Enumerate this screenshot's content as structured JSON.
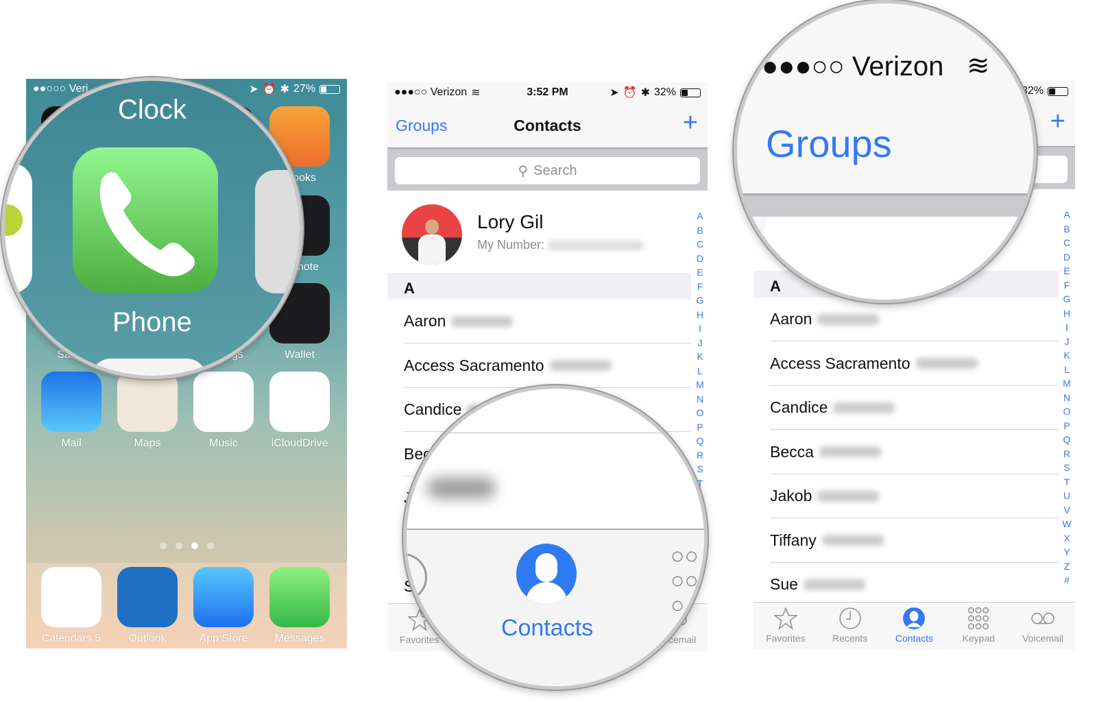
{
  "home": {
    "status": {
      "carrier": "●●○○○ Veri",
      "battery": "27%",
      "battery_level": 0.27
    },
    "magnifier": {
      "top_label": "Clock",
      "app_label": "Phone"
    },
    "rows": [
      [
        {
          "label": "",
          "icon": "clock-icon",
          "bg": "#111"
        },
        {
          "label": "",
          "icon": "blank",
          "bg": "#111"
        },
        {
          "label": "",
          "icon": "blank",
          "bg": "#111"
        },
        {
          "label": "iBooks",
          "icon": "book-icon",
          "bg": "linear-gradient(#f5a43a,#ef6c2c)"
        }
      ],
      [
        {
          "label": "",
          "icon": "blank",
          "bg": "transparent"
        },
        {
          "label": "",
          "icon": "blank",
          "bg": "transparent"
        },
        {
          "label": "",
          "icon": "blank",
          "bg": "transparent"
        },
        {
          "label": "Remote",
          "icon": "tv-icon",
          "bg": "#1c1c1e"
        }
      ],
      [
        {
          "label": "Safari",
          "icon": "blank",
          "bg": "transparent"
        },
        {
          "label": "",
          "icon": "blank",
          "bg": "transparent"
        },
        {
          "label": "Settings",
          "icon": "blank",
          "bg": "transparent"
        },
        {
          "label": "Wallet",
          "icon": "wallet-icon",
          "bg": "#1c1c1e"
        }
      ],
      [
        {
          "label": "Mail",
          "icon": "mail-icon",
          "bg": "linear-gradient(#1e73e8,#5ac8fa)"
        },
        {
          "label": "Maps",
          "icon": "maps-icon",
          "bg": "#efe8d8"
        },
        {
          "label": "Music",
          "icon": "music-icon",
          "bg": "#fff"
        },
        {
          "label": "iCloudDrive",
          "icon": "cloud-icon",
          "bg": "#fff"
        }
      ]
    ],
    "page_dots": {
      "count": 4,
      "active": 3
    },
    "dock": [
      {
        "label": "Calendars 5",
        "icon": "calendar-icon",
        "bg": "#fff"
      },
      {
        "label": "Outlook",
        "icon": "outlook-icon",
        "bg": "#1f6fc5"
      },
      {
        "label": "App Store",
        "icon": "appstore-icon",
        "bg": "linear-gradient(#5ac8fa,#1d6ff2)"
      },
      {
        "label": "Messages",
        "icon": "messages-icon",
        "bg": "linear-gradient(#8ef27c,#36b84a)"
      }
    ]
  },
  "contacts": {
    "status": {
      "carrier": "●●●○○ Verizon",
      "time": "3:52 PM",
      "battery": "32%",
      "battery_level": 0.32
    },
    "nav": {
      "left": "Groups",
      "title": "Contacts",
      "add": "+"
    },
    "search_placeholder": "Search",
    "me": {
      "name": "Lory Gil",
      "sub": "My Number:"
    },
    "section": "A",
    "rows": [
      "Aaron",
      "Access Sacramento",
      "Candice",
      "Becca",
      "Jakob",
      "Tiffany",
      "Sue"
    ],
    "index": [
      "A",
      "B",
      "C",
      "D",
      "E",
      "F",
      "G",
      "H",
      "I",
      "J",
      "K",
      "L",
      "M",
      "N",
      "O",
      "P",
      "Q",
      "R",
      "S",
      "T",
      "U",
      "V",
      "W",
      "X",
      "Y",
      "Z",
      "#"
    ],
    "tabs": [
      {
        "label": "Favorites",
        "icon": "star-icon"
      },
      {
        "label": "Recents",
        "icon": "clock-icon"
      },
      {
        "label": "Contacts",
        "icon": "person-icon",
        "active": true
      },
      {
        "label": "Keypad",
        "icon": "keypad-icon"
      },
      {
        "label": "Voicemail",
        "icon": "voicemail-icon"
      }
    ],
    "magnifier_tab": "Contacts",
    "magnifier_groups": "Groups",
    "magnifier_carrier": "●●●○○ Verizon",
    "accent": "#3478f6"
  }
}
